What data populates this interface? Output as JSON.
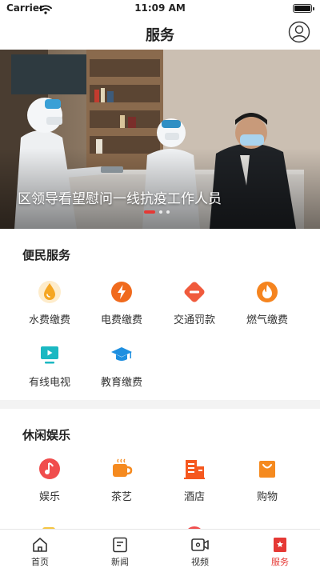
{
  "status_bar": {
    "carrier": "Carrier",
    "time": "11:09 AM"
  },
  "header": {
    "title": "服务"
  },
  "banner": {
    "caption": "区领导看望慰问一线抗疫工作人员",
    "slide_count": 3,
    "active_slide": 1
  },
  "sections": [
    {
      "title": "便民服务",
      "items": [
        {
          "label": "水费缴费",
          "icon": "water-drop-icon",
          "color": "#f5a623"
        },
        {
          "label": "电费缴费",
          "icon": "lightning-icon",
          "color": "#f06a1d"
        },
        {
          "label": "交通罚款",
          "icon": "traffic-sign-icon",
          "color": "#f05a3c"
        },
        {
          "label": "燃气缴费",
          "icon": "flame-icon",
          "color": "#f5841f"
        },
        {
          "label": "有线电视",
          "icon": "tv-icon",
          "color": "#1bb8c2"
        },
        {
          "label": "教育缴费",
          "icon": "graduation-cap-icon",
          "color": "#1e8fe0"
        }
      ]
    },
    {
      "title": "休闲娱乐",
      "items": [
        {
          "label": "娱乐",
          "icon": "music-note-icon",
          "color": "#f04d4d"
        },
        {
          "label": "茶艺",
          "icon": "tea-cup-icon",
          "color": "#f58a1f"
        },
        {
          "label": "酒店",
          "icon": "hotel-building-icon",
          "color": "#f5581f"
        },
        {
          "label": "购物",
          "icon": "shopping-bag-icon",
          "color": "#f58a1f"
        }
      ]
    }
  ],
  "tab_bar": {
    "tabs": [
      {
        "label": "首页",
        "icon": "home-icon"
      },
      {
        "label": "新闻",
        "icon": "news-icon"
      },
      {
        "label": "视频",
        "icon": "video-icon"
      },
      {
        "label": "服务",
        "icon": "service-bookmark-icon"
      }
    ],
    "active_index": 3,
    "active_color": "#e53935"
  }
}
